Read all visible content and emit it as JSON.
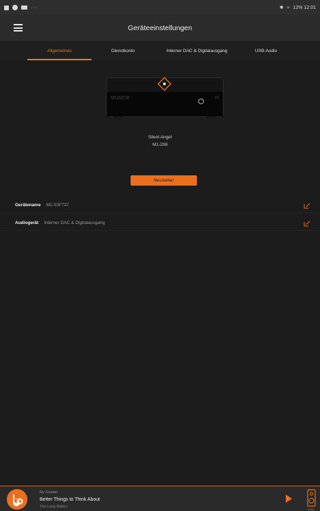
{
  "status_bar": {
    "overflow": "···",
    "right_text": "12% 12:01"
  },
  "app_bar": {
    "title": "Geräteeinstellungen"
  },
  "tabs": [
    {
      "label": "Allgemeines",
      "active": true
    },
    {
      "label": "Dienstkonto",
      "active": false
    },
    {
      "label": "Interner DAC & Digitalausgang",
      "active": false
    },
    {
      "label": "USB-Audio",
      "active": false
    }
  ],
  "device": {
    "brand_text": "MUSICR",
    "model_badge": "M1",
    "name_line1": "Silent Angel",
    "name_line2": "M1-208"
  },
  "restart_button": "Neustarten",
  "settings": [
    {
      "label": "Gerätename",
      "value": "M1-03F737"
    },
    {
      "label": "Audiogerät",
      "value": "Interner DAC & Digitalausgang"
    }
  ],
  "now_playing": {
    "artist": "Ry Cooder",
    "title": "Better Things to Think About",
    "album": "The Long Riders",
    "device_label": "Index"
  },
  "colors": {
    "accent": "#e8701f",
    "background": "#1c1c1c",
    "app_bar": "#2b2b2b"
  }
}
